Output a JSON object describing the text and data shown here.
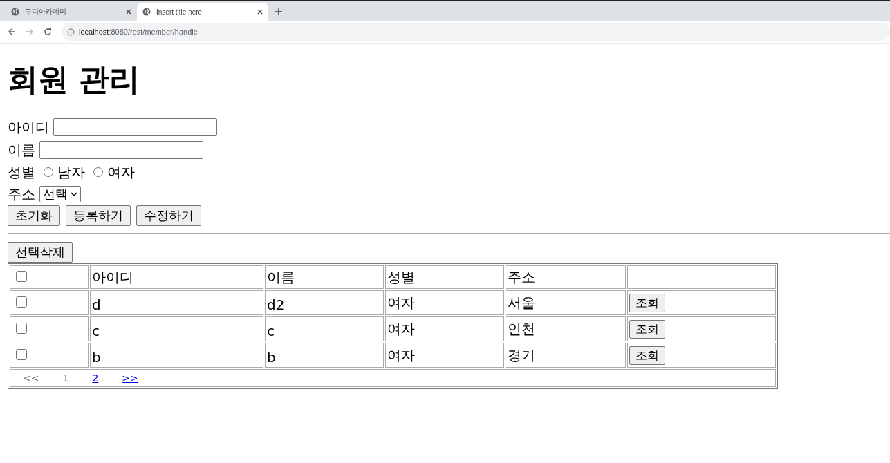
{
  "browser": {
    "tabs": [
      {
        "title": "구디아카데미",
        "selected": false
      },
      {
        "title": "Insert title here",
        "selected": true
      }
    ],
    "url_host": "localhost",
    "url_path": ":8080/rest/member/handle"
  },
  "heading": "회원 관리",
  "form": {
    "id_label": "아이디",
    "name_label": "이름",
    "gender_label": "성별",
    "gender_options": [
      {
        "label": "남자",
        "selected": false
      },
      {
        "label": "여자",
        "selected": false
      }
    ],
    "address_label": "주소",
    "address_value": "선택",
    "buttons": [
      "초기화",
      "등록하기",
      "수정하기"
    ]
  },
  "delete_button": "선택삭제",
  "table": {
    "columns": [
      "아이디",
      "이름",
      "성별",
      "주소"
    ],
    "header_checked": false,
    "rows": [
      {
        "checked": false,
        "id": "d",
        "name": "d2",
        "gender": "여자",
        "address": "서울",
        "action": "조회"
      },
      {
        "checked": false,
        "id": "c",
        "name": "c",
        "gender": "여자",
        "address": "인천",
        "action": "조회"
      },
      {
        "checked": false,
        "id": "b",
        "name": "b",
        "gender": "여자",
        "address": "경기",
        "action": "조회"
      }
    ],
    "pager": [
      {
        "label": "<<",
        "kind": "text"
      },
      {
        "label": "1",
        "kind": "text"
      },
      {
        "label": "2",
        "kind": "link"
      },
      {
        "label": ">>",
        "kind": "link"
      }
    ]
  }
}
